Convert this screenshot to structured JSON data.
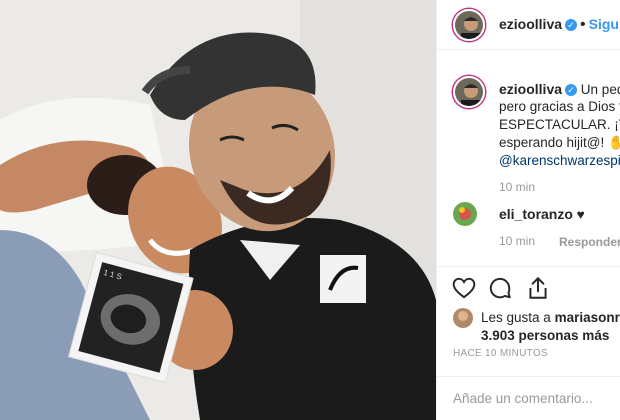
{
  "post": {
    "author": "ezioolliva",
    "follow_label": "Siguiendo",
    "caption_lines": [
      "Un pequeño",
      "pero gracias a Dios t",
      "ESPECTACULAR. ¡Te",
      "esperando hijit@! "
    ],
    "mention": "@karenschwarzespir",
    "caption_time": "10 min"
  },
  "comments": [
    {
      "user": "eli_toranzo",
      "text": "♥",
      "time": "10 min",
      "reply_label": "Responder"
    }
  ],
  "likes": {
    "prefix": "Les gusta a ",
    "user": "mariasonris",
    "rest": "3.903 personas más"
  },
  "timestamp": "HACE 10 MINUTOS",
  "add_comment_placeholder": "Añade un comentario...",
  "photo": {
    "ultrasound_text": "1 1   S"
  },
  "icons": {
    "like": "heart-outline-icon",
    "comment": "comment-bubble-icon",
    "share": "share-arrow-icon",
    "verified": "verified-badge-icon"
  },
  "colors": {
    "accent_blue": "#3897f0",
    "verified_blue": "#3897f0",
    "text_primary": "#262626",
    "text_secondary": "#999999",
    "mention_link": "#003569"
  }
}
